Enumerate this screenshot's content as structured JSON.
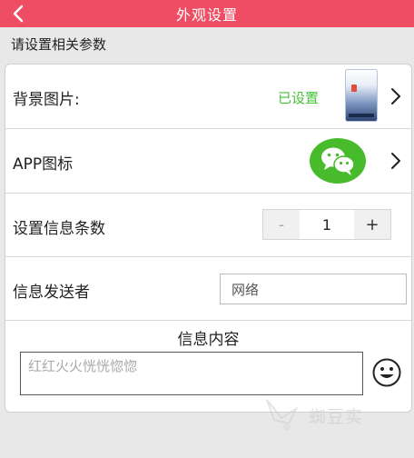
{
  "header": {
    "title": "外观设置"
  },
  "section": {
    "label": "请设置相关参数"
  },
  "rows": {
    "background": {
      "label": "背景图片:",
      "status": "已设置"
    },
    "app_icon": {
      "label": "APP图标",
      "icon": "wechat-icon"
    },
    "message_count": {
      "label": "设置信息条数",
      "minus": "-",
      "value": "1",
      "plus": "+"
    },
    "sender": {
      "label": "信息发送者",
      "value": "网络"
    },
    "content": {
      "label": "信息内容",
      "value": "红红火火恍恍惚惚"
    }
  },
  "watermark": {
    "text": "蜘豆实"
  },
  "colors": {
    "accent": "#ee4d63",
    "status_green": "#45c23a",
    "wechat_green": "#48bb2c"
  }
}
